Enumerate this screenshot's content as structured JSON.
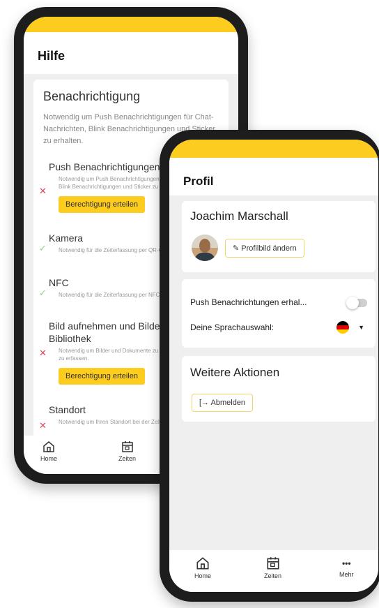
{
  "help_screen": {
    "title": "Hilfe",
    "section_title": "Benachrichtigung",
    "section_intro": "Notwendig um Push Benachrichtigungen für Chat-Nachrichten, Blink Benachrichtigungen und Sticker zu erhalten.",
    "permissions": [
      {
        "title": "Push Benachrichtigungen",
        "description": "Notwendig um Push Benachrichtigungen für Chat-Nachrichten, Blink Benachrichtigungen und Sticker zu erhalten.",
        "status": "denied",
        "button": "Berechtigung erteilen"
      },
      {
        "title": "Kamera",
        "description": "Notwendig für die Zeiterfassung per QR-Code.",
        "status": "granted",
        "button": ""
      },
      {
        "title": "NFC",
        "description": "Notwendig für die Zeiterfassung per NFC-Tag.",
        "status": "granted",
        "button": ""
      },
      {
        "title": "Bild aufnehmen und Bilder aus der Bibliothek",
        "description": "Notwendig um Bilder und Dokumente zu Ihren Zeiten und Tickets zu erfassen.",
        "status": "denied",
        "button": "Berechtigung erteilen"
      },
      {
        "title": "Standort",
        "description": "Notwendig um Ihren Standort bei der Zeiterfassung zu erfassen.",
        "status": "denied",
        "button": ""
      }
    ],
    "nav": {
      "home": "Home",
      "times": "Zeiten"
    }
  },
  "profile_screen": {
    "title": "Profil",
    "user_name": "Joachim Marschall",
    "change_picture_label": "Profilbild ändern",
    "push_label": "Push Benachrichtungen erhal...",
    "push_enabled": false,
    "language_label": "Deine Sprachauswahl:",
    "language_flag": "de",
    "actions_title": "Weitere Aktionen",
    "logout_label": "Abmelden",
    "nav": {
      "home": "Home",
      "times": "Zeiten",
      "more": "Mehr",
      "more_icon": "•••"
    }
  },
  "colors": {
    "accent": "#fccc1f",
    "denied": "#e0475b",
    "granted": "#9bcf7a",
    "device": "#1d1d1d"
  }
}
